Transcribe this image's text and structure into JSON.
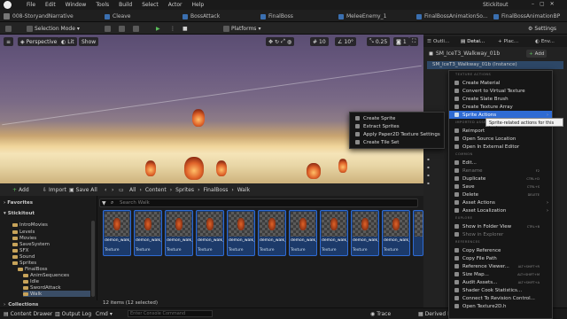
{
  "menubar": {
    "items": [
      "File",
      "Edit",
      "Window",
      "Tools",
      "Build",
      "Select",
      "Actor",
      "Help"
    ],
    "title": "Stickitout"
  },
  "project_tabs": {
    "project": "008-StoryandNarrative",
    "tabs": [
      "Cleave",
      "BossAttack",
      "FinalBoss",
      "MeleeEnemy_1",
      "FinalBossAnimationSo...",
      "FinalBossAnimationBP"
    ]
  },
  "toolbar": {
    "selection_mode": "Selection Mode",
    "platforms": "Platforms",
    "settings": "Settings"
  },
  "viewport": {
    "perspective": "Perspective",
    "lit": "Lit",
    "show": "Show",
    "fov": "90°",
    "snap": "10",
    "rot": "10°",
    "scale": "0.25",
    "cam": "1"
  },
  "content_browser": {
    "add": "Add",
    "import": "Import",
    "save_all": "Save All",
    "breadcrumb": [
      "All",
      "Content",
      "Sprites",
      "FinalBoss",
      "Walk"
    ],
    "search_placeholder": "Search Walk",
    "favorites": "Favorites",
    "root": "Stickitout",
    "status": "12 items (12 selected)",
    "settings": "Settings",
    "tree": [
      "IntroMovies",
      "Levels",
      "Movies",
      "SaveSystem",
      "SFX",
      "Sound",
      "Sprites",
      "FinalBoss",
      "AnimSequences",
      "Idle",
      "SwordAttack",
      "Walk"
    ],
    "collections": "Collections",
    "assets": [
      {
        "name": "demon_walk_1",
        "type": "Texture"
      },
      {
        "name": "demon_walk_2",
        "type": "Texture"
      },
      {
        "name": "demon_walk_3",
        "type": "Texture"
      },
      {
        "name": "demon_walk_4",
        "type": "Texture"
      },
      {
        "name": "demon_walk_5",
        "type": "Texture"
      },
      {
        "name": "demon_walk_6",
        "type": "Texture"
      },
      {
        "name": "demon_walk_7",
        "type": "Texture"
      },
      {
        "name": "demon_walk_8",
        "type": "Texture"
      },
      {
        "name": "demon_walk_9",
        "type": "Texture"
      },
      {
        "name": "demon_walk_10",
        "type": "Texture"
      },
      {
        "name": "demon_walk_11",
        "type": "Texture"
      },
      {
        "name": "demon_walk_12",
        "type": "Texture"
      }
    ]
  },
  "statusbar": {
    "content_drawer": "Content Drawer",
    "output_log": "Output Log",
    "cmd": "Cmd",
    "console_placeholder": "Enter Console Command",
    "trace": "Trace",
    "derived": "Derived D"
  },
  "right_panel": {
    "tabs": [
      "Outli...",
      "Detai...",
      "Plac...",
      "Env..."
    ],
    "selected": "SM_IceT3_Walkway_01b",
    "instance": "SM_IceT3_Walkway_01b (Instance)",
    "add": "Add"
  },
  "context_menu": {
    "texture_actions_header": "TEXTURE ACTIONS",
    "texture_actions": [
      "Create Material",
      "Convert to Virtual Texture",
      "Create Slate Brush",
      "Create Texture Array",
      "Sprite Actions"
    ],
    "imported_header": "IMPORTED ASSET",
    "imported": [
      "Reimport",
      "Open Source Location",
      "Open In External Editor"
    ],
    "common_header": "COMMON",
    "common": [
      {
        "label": "Edit...",
        "sc": ""
      },
      {
        "label": "Rename",
        "sc": "F2"
      },
      {
        "label": "Duplicate",
        "sc": "CTRL+D"
      },
      {
        "label": "Save",
        "sc": "CTRL+S"
      },
      {
        "label": "Delete",
        "sc": "DELETE"
      },
      {
        "label": "Asset Actions",
        "sc": ""
      },
      {
        "label": "Asset Localization",
        "sc": ""
      }
    ],
    "explore_header": "EXPLORE",
    "explore": [
      {
        "label": "Show in Folder View",
        "sc": "CTRL+B"
      },
      {
        "label": "Show in Explorer",
        "sc": ""
      }
    ],
    "references_header": "REFERENCES",
    "references": [
      {
        "label": "Copy Reference",
        "sc": ""
      },
      {
        "label": "Copy File Path",
        "sc": ""
      },
      {
        "label": "Reference Viewer...",
        "sc": "ALT+SHIFT+R"
      },
      {
        "label": "Size Map...",
        "sc": "ALT+SHIFT+M"
      },
      {
        "label": "Audit Assets...",
        "sc": "ALT+SHIFT+A"
      },
      {
        "label": "Shader Cook Statistics...",
        "sc": ""
      },
      {
        "label": "Connect To Revision Control...",
        "sc": ""
      },
      {
        "label": "Open Texture2D.h",
        "sc": ""
      }
    ],
    "tooltip": "Sprite-related actions for this texture."
  },
  "submenu": {
    "items": [
      "Create Sprite",
      "Extract Sprites",
      "Apply Paper2D Texture Settings",
      "Create Tile Set"
    ]
  }
}
